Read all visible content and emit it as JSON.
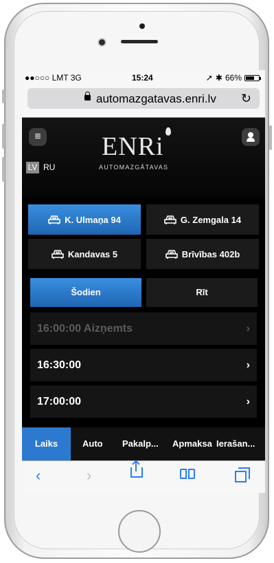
{
  "status_bar": {
    "carrier": "●●○○○ LMT  3G",
    "time": "15:24",
    "battery": "66%"
  },
  "browser": {
    "url": "automazgatavas.enri.lv"
  },
  "header": {
    "logo_text": "ENRi",
    "logo_subtitle": "AUTOMAZGĀTAVAS",
    "lang_active": "LV",
    "lang_other": "RU"
  },
  "locations": [
    {
      "label": "K. Ulmaņa 94",
      "active": true
    },
    {
      "label": "G. Zemgala 14",
      "active": false
    },
    {
      "label": "Kandavas 5",
      "active": false
    },
    {
      "label": "Brīvības 402b",
      "active": false
    }
  ],
  "days": [
    {
      "label": "Šodien",
      "active": true
    },
    {
      "label": "Rīt",
      "active": false
    }
  ],
  "slots": [
    {
      "label": "16:00:00 Aizņemts",
      "disabled": true
    },
    {
      "label": "16:30:00",
      "disabled": false
    },
    {
      "label": "17:00:00",
      "disabled": false
    }
  ],
  "bottom_tabs": [
    {
      "label": "Laiks",
      "active": true
    },
    {
      "label": "Auto",
      "active": false
    },
    {
      "label": "Pakalp...",
      "active": false
    },
    {
      "label": "Apmaksa",
      "active": false
    },
    {
      "label": "Ierašan...",
      "active": false
    }
  ],
  "colors": {
    "accent": "#2b7ad0",
    "ios_blue": "#2a7cf6",
    "app_bg": "#000000"
  },
  "icons": {
    "menu": "menu-icon",
    "user": "user-icon",
    "car_wash": "car-wash-icon",
    "chevron": "chevron-right-icon",
    "back": "back-icon",
    "forward": "forward-icon",
    "share": "share-icon",
    "bookmarks": "bookmarks-icon",
    "tabs": "tabs-icon",
    "lock": "lock-icon",
    "reload": "reload-icon"
  }
}
